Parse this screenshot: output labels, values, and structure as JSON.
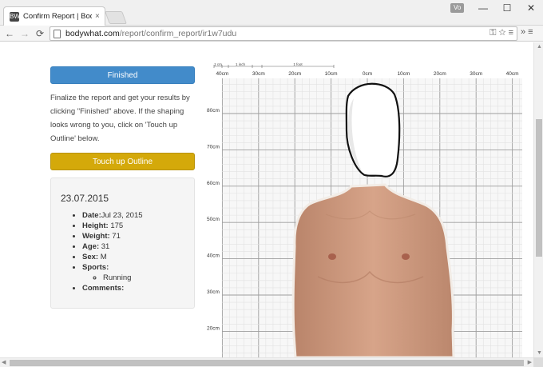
{
  "browser": {
    "tab_title": "Confirm Report | BodyWh",
    "tab_close": "×",
    "favicon": "BW",
    "user_badge": "Vo",
    "url_domain": "bodywhat.com",
    "url_path": "/report/confirm_report/ir1w7udu",
    "window_controls": {
      "minimize": "—",
      "maximize": "☐",
      "close": "✕"
    },
    "nav": {
      "back": "←",
      "forward": "→",
      "reload": "⟳"
    },
    "omni_icons": "⚿ ☆ ≡",
    "menu": "» ≡"
  },
  "page": {
    "finished_button": "Finished",
    "instructions": "Finalize the report and get your results by clicking \"Finished\" above. If the shaping looks wrong to you, click on 'Touch up Outline' below.",
    "touchup_button": "Touch up Outline",
    "card": {
      "date": "23.07.2015",
      "fields": [
        {
          "label": "Date:",
          "value": "Jul 23, 2015"
        },
        {
          "label": "Height:",
          "value": " 175"
        },
        {
          "label": "Weight:",
          "value": " 71"
        },
        {
          "label": "Age:",
          "value": " 31"
        },
        {
          "label": "Sex:",
          "value": " M"
        },
        {
          "label": "Sports:",
          "value": ""
        }
      ],
      "sports": [
        "Running"
      ],
      "comments_label": "Comments:"
    },
    "grid": {
      "top_ticks": [
        "40",
        "30",
        "20",
        "10",
        "0",
        "10",
        "20",
        "30",
        "40"
      ],
      "left_ticks": [
        "80",
        "70",
        "60",
        "50",
        "40",
        "30",
        "20"
      ],
      "unit": "cm",
      "scale_labels": [
        "1 cm",
        "1 inch",
        "1 foot"
      ]
    },
    "colors": {
      "finished": "#428bca",
      "touchup": "#d4a90a",
      "skin": "#cf9a7f",
      "grid_minor": "#e2e2e2",
      "grid_major": "#9e9e9e"
    }
  }
}
